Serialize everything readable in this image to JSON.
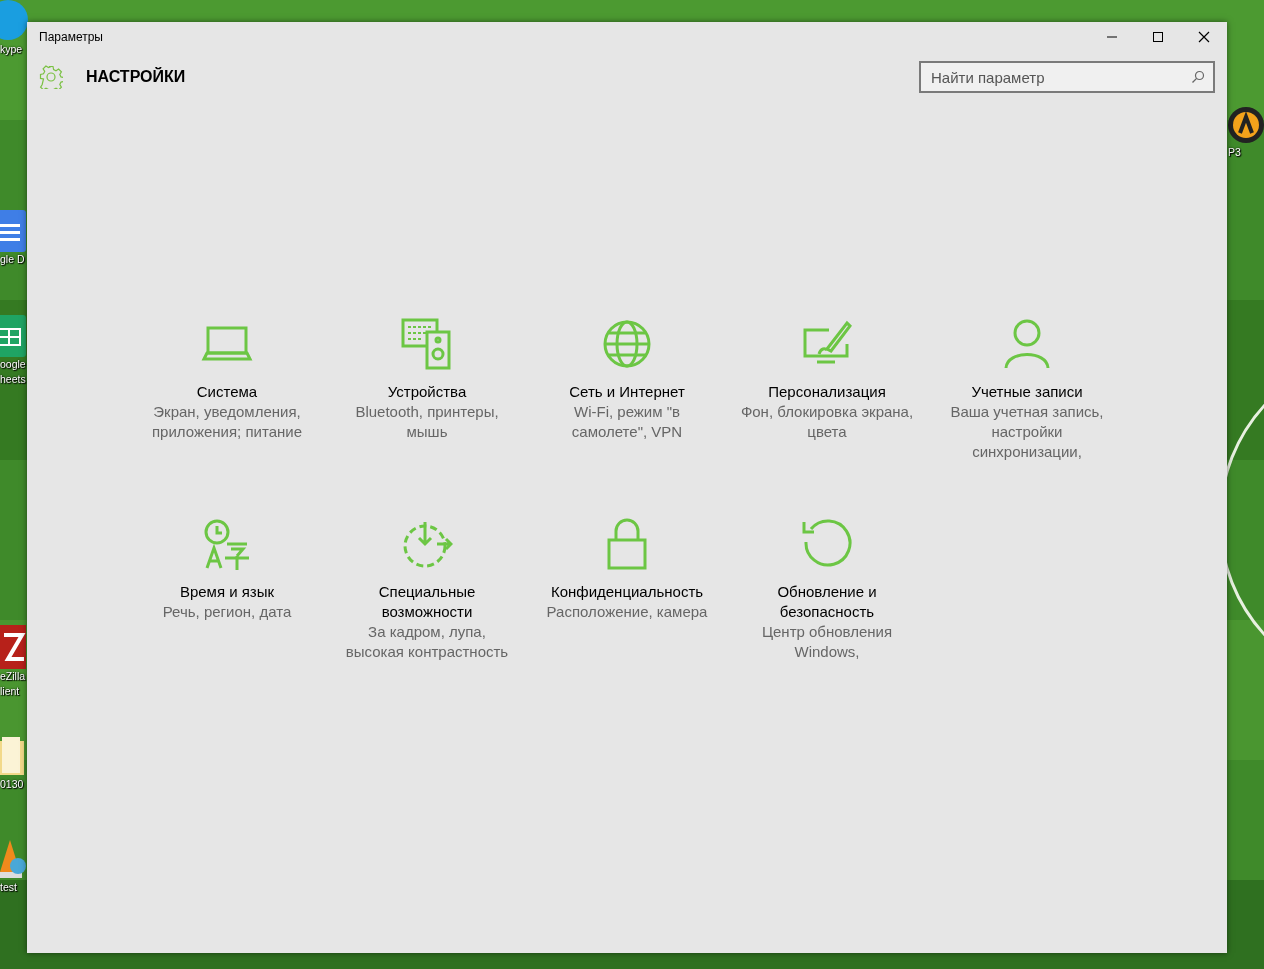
{
  "desktop": {
    "icons": [
      {
        "labels": [
          "kype"
        ]
      },
      {
        "labels": [
          "gle D"
        ]
      },
      {
        "labels": [
          "oogle",
          "heets"
        ]
      },
      {
        "labels": [
          "eZilla",
          "lient"
        ]
      },
      {
        "labels": [
          "0130"
        ]
      },
      {
        "labels": [
          "test"
        ]
      },
      {
        "labels": [
          "P3"
        ]
      }
    ]
  },
  "window": {
    "title": "Параметры"
  },
  "header": {
    "title": "НАСТРОЙКИ"
  },
  "search": {
    "placeholder": "Найти параметр"
  },
  "categories": [
    {
      "title": "Система",
      "description": "Экран, уведомления, приложения; питание"
    },
    {
      "title": "Устройства",
      "description": "Bluetooth, принтеры, мышь"
    },
    {
      "title": "Сеть и Интернет",
      "description": "Wi-Fi, режим \"в самолете\", VPN"
    },
    {
      "title": "Персонализация",
      "description": "Фон, блокировка экрана, цвета"
    },
    {
      "title": "Учетные записи",
      "description": "Ваша учетная запись, настройки синхронизации,"
    },
    {
      "title": "Время и язык",
      "description": "Речь, регион, дата"
    },
    {
      "title": "Специальные возможности",
      "description": "За кадром, лупа, высокая контрастность"
    },
    {
      "title": "Конфиденциальность",
      "description": "Расположение, камера"
    },
    {
      "title": "Обновление и безопасность",
      "description": "Центр обновления Windows,"
    }
  ]
}
